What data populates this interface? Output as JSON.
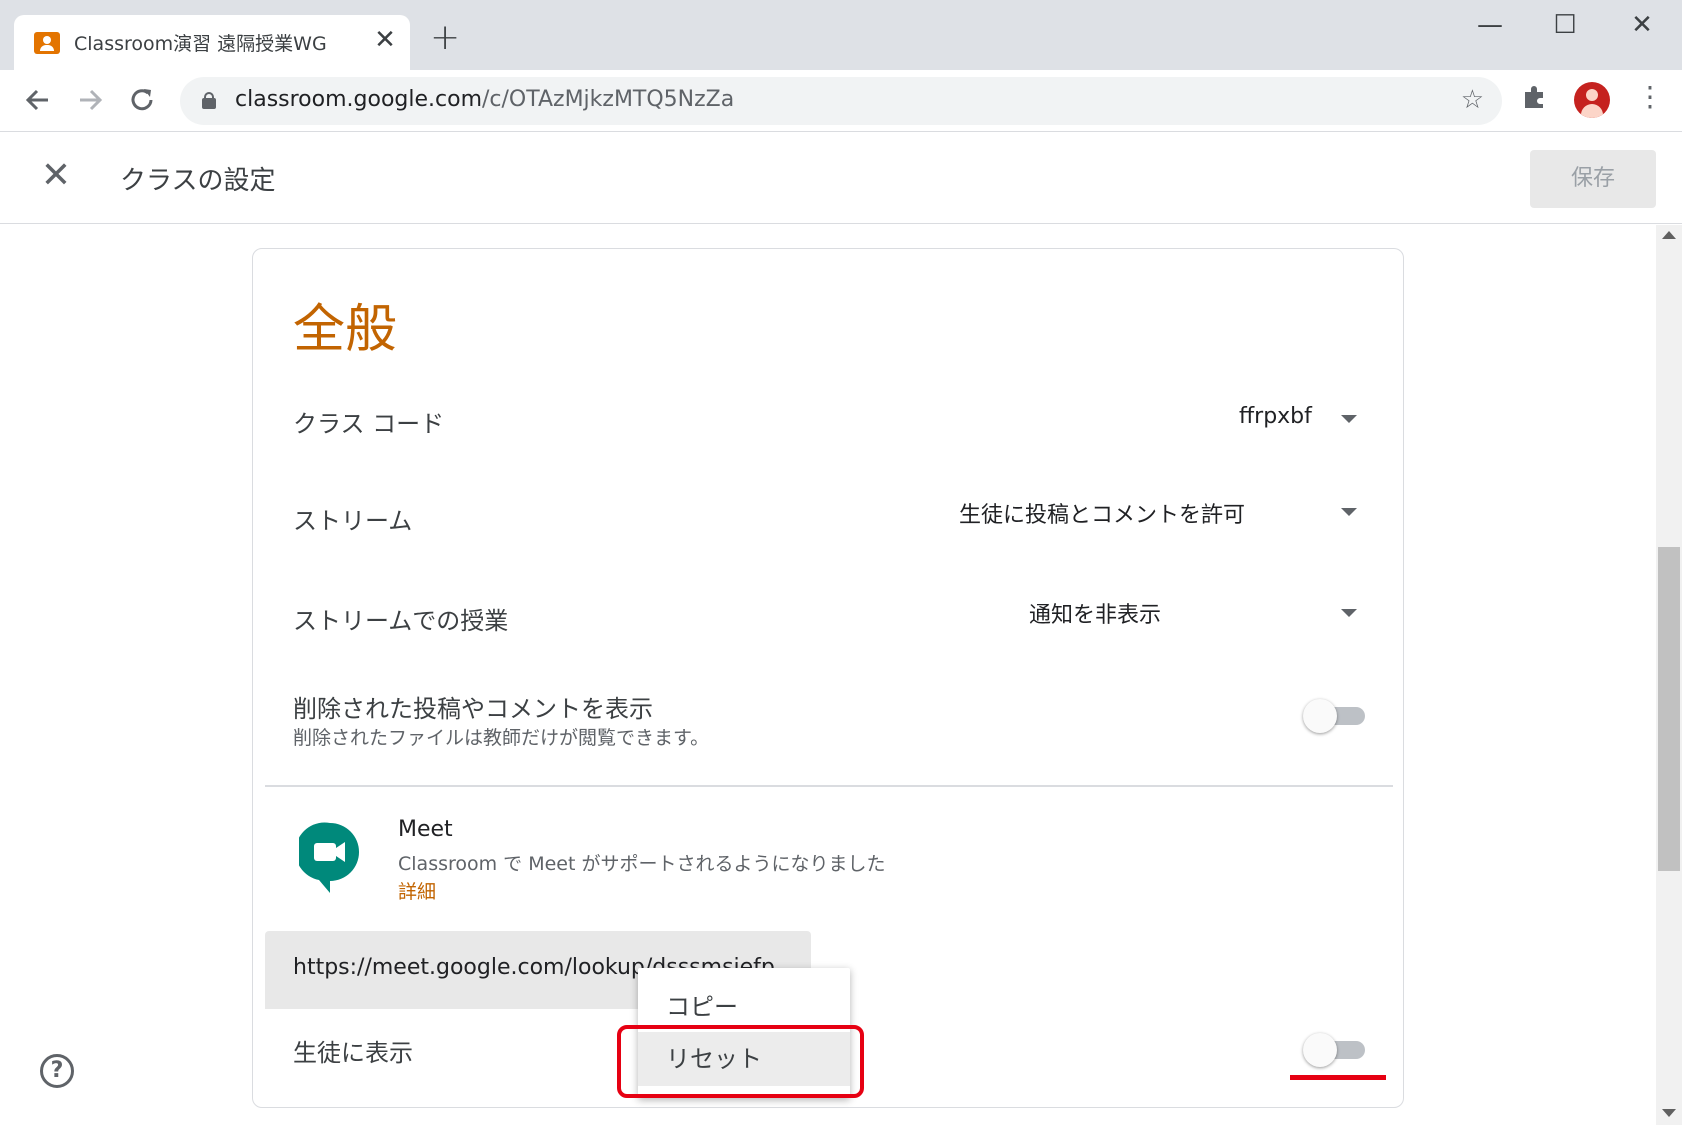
{
  "browser": {
    "tab_title": "Classroom演習 遠隔授業WG",
    "tab_close": "✕",
    "new_tab": "+",
    "url_host": "classroom.google.com",
    "url_path": "/c/OTAzMjkzMTQ5NzZa",
    "window_controls": {
      "minimize": "—",
      "maximize": "☐",
      "close": "✕"
    }
  },
  "header": {
    "title": "クラスの設定",
    "close": "✕",
    "save_label": "保存"
  },
  "general": {
    "section_title": "全般",
    "class_code": {
      "label": "クラス コード",
      "value": "ffrpxbf"
    },
    "stream": {
      "label": "ストリーム",
      "value": "生徒に投稿とコメントを許可"
    },
    "stream_classwork": {
      "label": "ストリームでの授業",
      "value": "通知を非表示"
    },
    "show_deleted": {
      "label": "削除された投稿やコメントを表示",
      "sublabel": "削除されたファイルは教師だけが閲覧できます。",
      "enabled": false
    }
  },
  "meet": {
    "title": "Meet",
    "description": "Classroom で Meet がサポートされるようになりました",
    "details_link": "詳細",
    "link_value": "https://meet.google.com/lookup/dsssmsiefp",
    "visible_to_students": {
      "label": "生徒に表示",
      "enabled": false
    }
  },
  "link_menu": {
    "items": [
      {
        "label": "コピー"
      },
      {
        "label": "リセット"
      }
    ]
  },
  "colors": {
    "accent": "#c26401",
    "highlight": "#e60012",
    "meet_green": "#00897b"
  },
  "icons": {
    "back": "arrow-left-icon",
    "forward": "arrow-right-icon",
    "reload": "reload-icon",
    "star": "star-icon",
    "extensions": "puzzle-icon",
    "help": "help-icon"
  }
}
